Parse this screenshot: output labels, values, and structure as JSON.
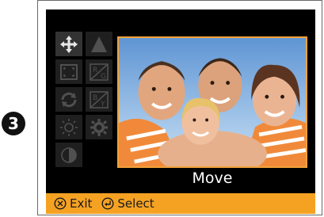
{
  "step": {
    "number": "3"
  },
  "menu": {
    "icons": [
      {
        "name": "move-icon",
        "state": "active"
      },
      {
        "name": "triangle-icon",
        "state": "inactive"
      },
      {
        "name": "crop-frame-icon",
        "state": "inactive"
      },
      {
        "name": "rg-color-icon",
        "state": "inactive"
      },
      {
        "name": "rotate-icon",
        "state": "inactive"
      },
      {
        "name": "by-color-icon",
        "state": "inactive"
      },
      {
        "name": "brightness-icon",
        "state": "inactive"
      },
      {
        "name": "gear-settings-icon",
        "state": "inactive"
      },
      {
        "name": "contrast-icon",
        "state": "inactive"
      }
    ],
    "rg_label_top": "R",
    "rg_label_bottom": "G",
    "by_label_top": "B",
    "by_label_bottom": "Y"
  },
  "preview": {
    "mode_label": "Move"
  },
  "footer": {
    "exit_label": "Exit",
    "select_label": "Select"
  },
  "colors": {
    "accent": "#f5a223",
    "screen_bg": "#000000",
    "icon_active": "#e8e8e8",
    "icon_inactive": "#505050"
  }
}
